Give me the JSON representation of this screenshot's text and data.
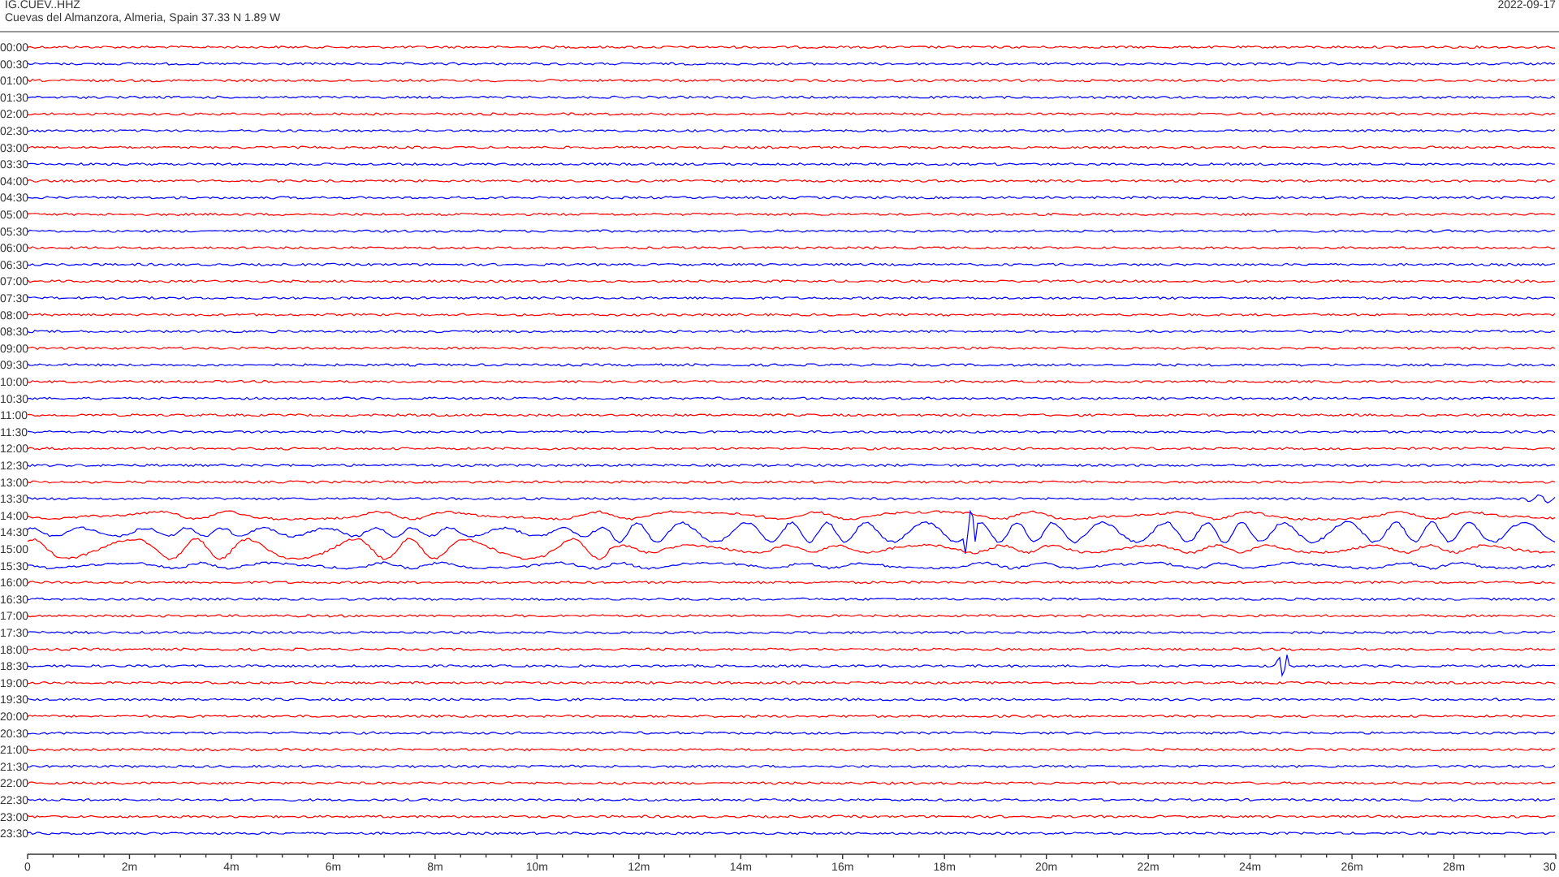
{
  "header": {
    "channel": "IG.CUEV..HHZ",
    "location": "Cuevas del Almanzora, Almeria, Spain  37.33 N 1.89 W",
    "date": "2022-09-17"
  },
  "rows": [
    {
      "time": "00:00",
      "color": "#ff0000"
    },
    {
      "time": "00:30",
      "color": "#0000ff"
    },
    {
      "time": "01:00",
      "color": "#ff0000"
    },
    {
      "time": "01:30",
      "color": "#0000ff"
    },
    {
      "time": "02:00",
      "color": "#ff0000"
    },
    {
      "time": "02:30",
      "color": "#0000ff"
    },
    {
      "time": "03:00",
      "color": "#ff0000"
    },
    {
      "time": "03:30",
      "color": "#0000ff"
    },
    {
      "time": "04:00",
      "color": "#ff0000"
    },
    {
      "time": "04:30",
      "color": "#0000ff"
    },
    {
      "time": "05:00",
      "color": "#ff0000"
    },
    {
      "time": "05:30",
      "color": "#0000ff"
    },
    {
      "time": "06:00",
      "color": "#ff0000"
    },
    {
      "time": "06:30",
      "color": "#0000ff"
    },
    {
      "time": "07:00",
      "color": "#ff0000"
    },
    {
      "time": "07:30",
      "color": "#0000ff"
    },
    {
      "time": "08:00",
      "color": "#ff0000"
    },
    {
      "time": "08:30",
      "color": "#0000ff"
    },
    {
      "time": "09:00",
      "color": "#ff0000"
    },
    {
      "time": "09:30",
      "color": "#0000ff"
    },
    {
      "time": "10:00",
      "color": "#ff0000"
    },
    {
      "time": "10:30",
      "color": "#0000ff"
    },
    {
      "time": "11:00",
      "color": "#ff0000"
    },
    {
      "time": "11:30",
      "color": "#0000ff"
    },
    {
      "time": "12:00",
      "color": "#ff0000"
    },
    {
      "time": "12:30",
      "color": "#0000ff"
    },
    {
      "time": "13:00",
      "color": "#ff0000"
    },
    {
      "time": "13:30",
      "color": "#0000ff"
    },
    {
      "time": "14:00",
      "color": "#ff0000"
    },
    {
      "time": "14:30",
      "color": "#0000ff"
    },
    {
      "time": "15:00",
      "color": "#ff0000"
    },
    {
      "time": "15:30",
      "color": "#0000ff"
    },
    {
      "time": "16:00",
      "color": "#ff0000"
    },
    {
      "time": "16:30",
      "color": "#0000ff"
    },
    {
      "time": "17:00",
      "color": "#ff0000"
    },
    {
      "time": "17:30",
      "color": "#0000ff"
    },
    {
      "time": "18:00",
      "color": "#ff0000"
    },
    {
      "time": "18:30",
      "color": "#0000ff"
    },
    {
      "time": "19:00",
      "color": "#ff0000"
    },
    {
      "time": "19:30",
      "color": "#0000ff"
    },
    {
      "time": "20:00",
      "color": "#ff0000"
    },
    {
      "time": "20:30",
      "color": "#0000ff"
    },
    {
      "time": "21:00",
      "color": "#ff0000"
    },
    {
      "time": "21:30",
      "color": "#0000ff"
    },
    {
      "time": "22:00",
      "color": "#ff0000"
    },
    {
      "time": "22:30",
      "color": "#0000ff"
    },
    {
      "time": "23:00",
      "color": "#ff0000"
    },
    {
      "time": "23:30",
      "color": "#0000ff"
    }
  ],
  "x_axis": {
    "labels": [
      "0",
      "2m",
      "4m",
      "6m",
      "8m",
      "10m",
      "12m",
      "14m",
      "16m",
      "18m",
      "20m",
      "22m",
      "24m",
      "26m",
      "28m",
      "30"
    ]
  }
}
